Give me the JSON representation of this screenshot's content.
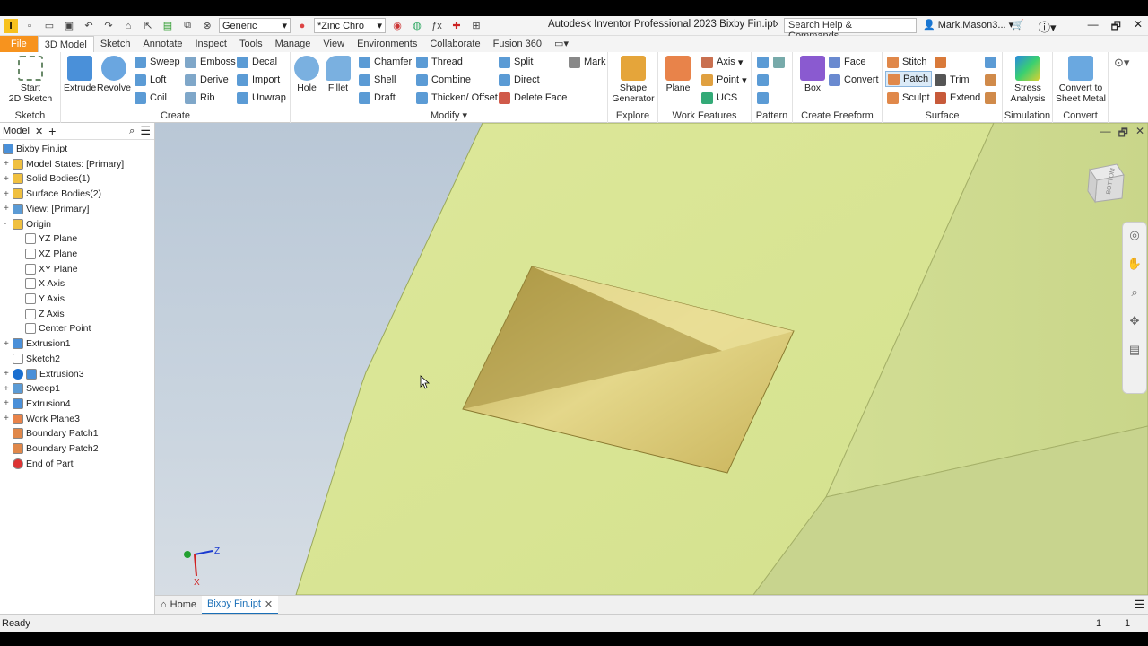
{
  "titlebar": {
    "style_combo": "Generic",
    "material_combo": "*Zinc Chro",
    "app_title": "Autodesk Inventor Professional 2023   Bixby Fin.ipt",
    "search_placeholder": "Search Help & Commands...",
    "user": "Mark.Mason3...",
    "minimize": "—",
    "restore": "🗗",
    "close": "✕"
  },
  "tabs": [
    "File",
    "3D Model",
    "Sketch",
    "Annotate",
    "Inspect",
    "Tools",
    "Manage",
    "View",
    "Environments",
    "Collaborate",
    "Fusion 360"
  ],
  "ribbon": {
    "sketch": {
      "label": "Sketch",
      "start": "Start\n2D Sketch"
    },
    "create": {
      "label": "Create",
      "extrude": "Extrude",
      "revolve": "Revolve",
      "sweep": "Sweep",
      "loft": "Loft",
      "coil": "Coil",
      "emboss": "Emboss",
      "derive": "Derive",
      "rib": "Rib",
      "decal": "Decal",
      "import": "Import",
      "unwrap": "Unwrap"
    },
    "modify": {
      "label": "Modify",
      "hole": "Hole",
      "fillet": "Fillet",
      "chamfer": "Chamfer",
      "shell": "Shell",
      "draft": "Draft",
      "thread": "Thread",
      "combine": "Combine",
      "thicken": "Thicken/ Offset",
      "split": "Split",
      "direct": "Direct",
      "delete_face": "Delete Face",
      "mark": "Mark"
    },
    "explore": {
      "label": "Explore",
      "shape": "Shape\nGenerator"
    },
    "work": {
      "label": "Work Features",
      "plane": "Plane",
      "axis": "Axis",
      "point": "Point",
      "ucs": "UCS"
    },
    "pattern": {
      "label": "Pattern"
    },
    "freeform": {
      "label": "Create Freeform",
      "box": "Box",
      "face": "Face",
      "convert": "Convert"
    },
    "surface": {
      "label": "Surface",
      "stitch": "Stitch",
      "patch": "Patch",
      "sculpt": "Sculpt",
      "trim": "Trim",
      "extend": "Extend"
    },
    "simulation": {
      "label": "Simulation",
      "stress": "Stress\nAnalysis"
    },
    "convert": {
      "label": "Convert",
      "sheet": "Convert to\nSheet Metal"
    }
  },
  "browser": {
    "tab": "Model",
    "close": "✕",
    "add": "+",
    "nodes": [
      "Bixby Fin.ipt",
      "Model States: [Primary]",
      "Solid Bodies(1)",
      "Surface Bodies(2)",
      "View: [Primary]",
      "Origin",
      "YZ Plane",
      "XZ Plane",
      "XY Plane",
      "X Axis",
      "Y Axis",
      "Z Axis",
      "Center Point",
      "Extrusion1",
      "Sketch2",
      "Extrusion3",
      "Sweep1",
      "Extrusion4",
      "Work Plane3",
      "Boundary Patch1",
      "Boundary Patch2",
      "End of Part"
    ]
  },
  "viewcube": {
    "label": "BOTTOM"
  },
  "triad": {
    "x": "X",
    "z": "Z"
  },
  "doctabs": {
    "home": "Home",
    "file": "Bixby Fin.ipt"
  },
  "status": {
    "text": "Ready",
    "n1": "1",
    "n2": "1"
  }
}
